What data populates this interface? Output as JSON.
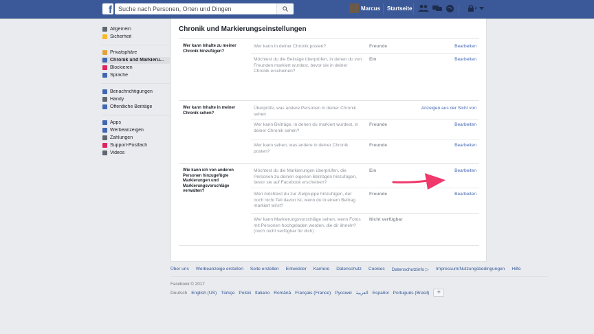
{
  "topbar": {
    "logo": "f",
    "search_placeholder": "Suche nach Personen, Orten und Dingen",
    "user_name": "Marcus",
    "home_label": "Startseite"
  },
  "sidebar": {
    "groups": [
      [
        {
          "label": "Allgemein",
          "icon": "gear-icon",
          "color": "#606770"
        },
        {
          "label": "Sicherheit",
          "icon": "shield-icon",
          "color": "#f7b928"
        }
      ],
      [
        {
          "label": "Privatsphäre",
          "icon": "lock-icon",
          "color": "#e4a23a"
        },
        {
          "label": "Chronik und Markieru...",
          "icon": "timeline-icon",
          "color": "#4267b2",
          "active": true
        },
        {
          "label": "Blockieren",
          "icon": "block-icon",
          "color": "#e0245e"
        },
        {
          "label": "Sprache",
          "icon": "language-icon",
          "color": "#4267b2"
        }
      ],
      [
        {
          "label": "Benachrichtigungen",
          "icon": "globe-icon",
          "color": "#4267b2"
        },
        {
          "label": "Handy",
          "icon": "mobile-icon",
          "color": "#606770"
        },
        {
          "label": "Öffentliche Beiträge",
          "icon": "rss-icon",
          "color": "#4267b2"
        }
      ],
      [
        {
          "label": "Apps",
          "icon": "apps-icon",
          "color": "#4267b2"
        },
        {
          "label": "Werbeanzeigen",
          "icon": "ads-icon",
          "color": "#4267b2"
        },
        {
          "label": "Zahlungen",
          "icon": "payments-icon",
          "color": "#606770"
        },
        {
          "label": "Support-Postfach",
          "icon": "support-icon",
          "color": "#e0245e"
        },
        {
          "label": "Videos",
          "icon": "video-icon",
          "color": "#606770"
        }
      ]
    ]
  },
  "main": {
    "title": "Chronik und Markierungseinstellungen",
    "sections": [
      {
        "label": "Wer kann Inhalte zu meiner Chronik hinzufügen?",
        "rows": [
          {
            "question": "Wer kann in deiner Chronik posten?",
            "value": "Freunde",
            "action": "Bearbeiten"
          },
          {
            "question": "Möchtest du die Beiträge überprüfen, in denen du von Freunden markiert wurdest, bevor sie in deiner Chronik erscheinen?",
            "value": "Ein",
            "action": "Bearbeiten"
          }
        ]
      },
      {
        "label": "Wer kann Inhalte in meiner Chronik sehen?",
        "rows": [
          {
            "question": "Überprüfe, was andere Personen in deiner Chronik sehen",
            "value": "",
            "action": "Anzeigen aus der Sicht von"
          },
          {
            "question": "Wer kann Beiträge, in denen du markiert wurdest, in deiner Chronik sehen?",
            "value": "Freunde",
            "action": "Bearbeiten"
          },
          {
            "question": "Wer kann sehen, was andere in deiner Chronik posten?",
            "value": "Freunde",
            "action": "Bearbeiten"
          }
        ]
      },
      {
        "label": "Wie kann ich von anderen Personen hinzugefügte Markierungen und Markierungsvorschläge verwalten?",
        "rows": [
          {
            "question": "Möchtest du die Markierungen überprüfen, die Personen zu deinen eigenen Beiträgen hinzufügen, bevor sie auf Facebook erscheinen?",
            "value": "Ein",
            "action": "Bearbeiten"
          },
          {
            "question": "Wen möchtest du zur Zielgruppe hinzufügen, der noch nicht Teil davon ist, wenn du in einem Beitrag markiert wirst?",
            "value": "Freunde",
            "action": "Bearbeiten"
          },
          {
            "question": "Wer kann Markierungsvorschläge sehen, wenn Fotos mit Personen hochgeladen werden, die dir ähneln? (noch nicht verfügbar für dich)",
            "value": "Nicht verfügbar",
            "action": ""
          }
        ]
      }
    ]
  },
  "footer": {
    "links": [
      "Über uns",
      "Werbeanzeige erstellen",
      "Seite erstellen",
      "Entwickler",
      "Karriere",
      "Datenschutz",
      "Cookies",
      "Datenschutzinfo ▷",
      "Impressum/Nutzungsbedingungen",
      "Hilfe"
    ],
    "copyright": "Facebook © 2017",
    "current_language": "Deutsch",
    "languages": [
      "English (US)",
      "Türkçe",
      "Polski",
      "Italiano",
      "Română",
      "Français (France)",
      "Русский",
      "العربية",
      "Español",
      "Português (Brasil)"
    ],
    "more_languages": "+"
  },
  "accent_colors": {
    "brand_blue": "#3b5998",
    "link_blue": "#4267b2",
    "annotation_arrow": "#f0386b"
  }
}
